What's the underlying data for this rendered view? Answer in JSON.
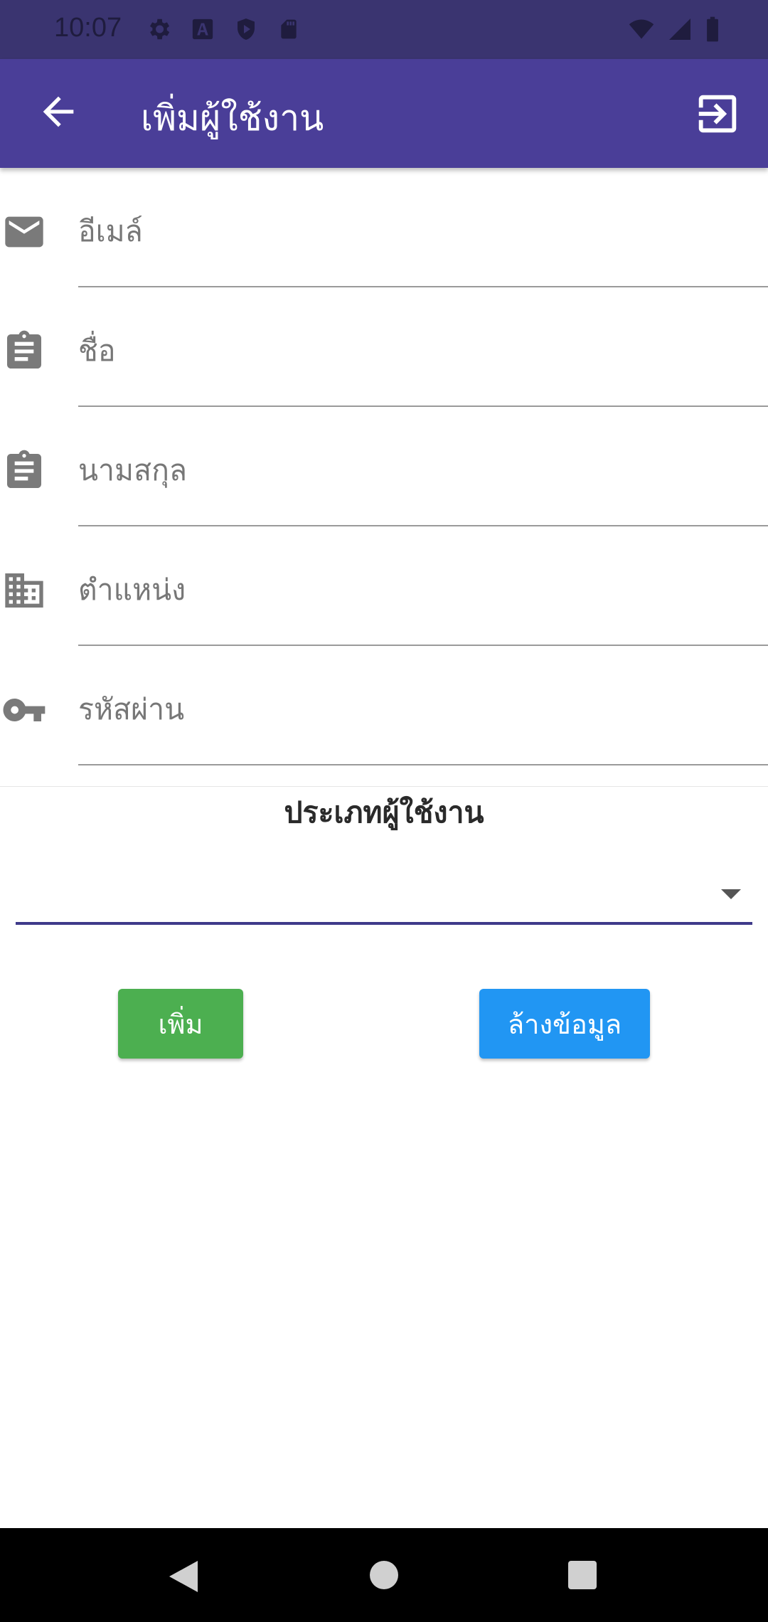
{
  "status_bar": {
    "time": "10:07",
    "left_icons": [
      "settings-icon",
      "font-a-icon",
      "shield-play-icon",
      "sd-card-icon"
    ],
    "right_icons": [
      "wifi-icon",
      "cell-signal-icon",
      "battery-icon"
    ]
  },
  "app_bar": {
    "title": "เพิ่มผู้ใช้งาน",
    "back_icon": "arrow-back-icon",
    "logout_icon": "logout-icon",
    "color": "#4a3e98"
  },
  "form": {
    "fields": [
      {
        "placeholder": "อีเมล์",
        "icon": "email-icon",
        "value": ""
      },
      {
        "placeholder": "ชื่อ",
        "icon": "clipboard-icon",
        "value": ""
      },
      {
        "placeholder": "นามสกุล",
        "icon": "clipboard-icon",
        "value": ""
      },
      {
        "placeholder": "ตำแหน่ง",
        "icon": "building-icon",
        "value": ""
      },
      {
        "placeholder": "รหัสผ่าน",
        "icon": "key-icon",
        "value": ""
      }
    ],
    "user_type_label": "ประเภทผู้ใช้งาน",
    "user_type_value": ""
  },
  "buttons": {
    "add": "เพิ่ม",
    "clear": "ล้างข้อมูล",
    "add_color": "#4caf50",
    "clear_color": "#2196f3"
  },
  "nav_bar": {
    "icons": [
      "nav-back-icon",
      "nav-home-icon",
      "nav-recents-icon"
    ]
  }
}
